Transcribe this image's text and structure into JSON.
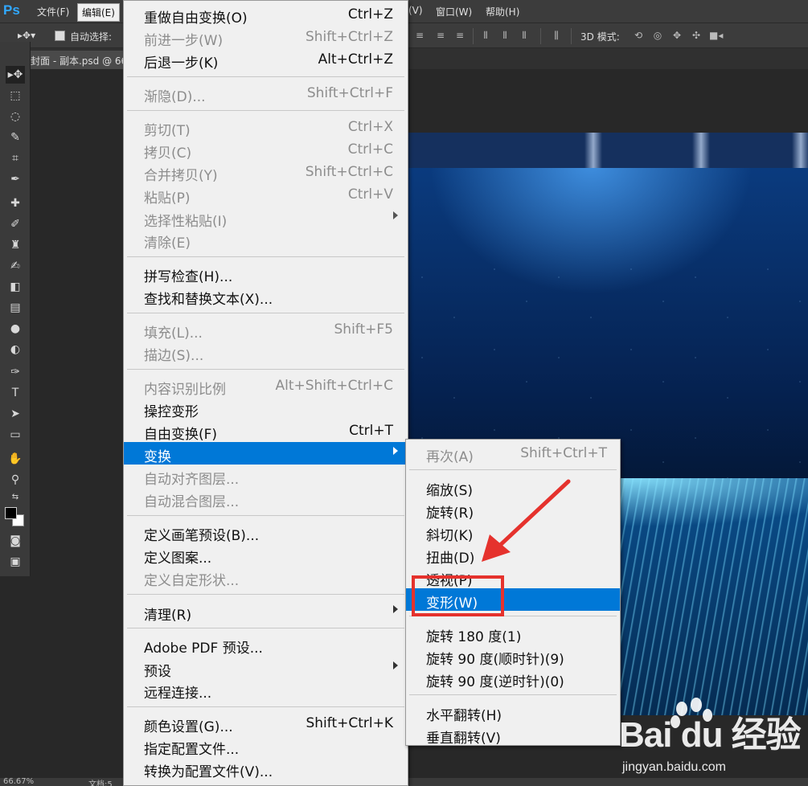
{
  "app": {
    "logo": "Ps",
    "menubar": [
      {
        "label": "文件(F)",
        "active": false
      },
      {
        "label": "编辑(E)",
        "active": true
      },
      {
        "label": "(V)",
        "active": false
      },
      {
        "label": "窗口(W)",
        "active": false
      },
      {
        "label": "帮助(H)",
        "active": false
      }
    ]
  },
  "options_bar": {
    "auto_select_label": "自动选择:",
    "mode_3d_label": "3D 模式:"
  },
  "document": {
    "tab_label": "封面 - 副本.psd @ 66"
  },
  "status": {
    "zoom": "66.67%",
    "doc_label": "文档:5"
  },
  "edit_menu": {
    "items": [
      {
        "label": "重做自由变换(O)",
        "shortcut": "Ctrl+Z",
        "disabled": false
      },
      {
        "label": "前进一步(W)",
        "shortcut": "Shift+Ctrl+Z",
        "disabled": true
      },
      {
        "label": "后退一步(K)",
        "shortcut": "Alt+Ctrl+Z",
        "disabled": false
      },
      {
        "label": "渐隐(D)...",
        "shortcut": "Shift+Ctrl+F",
        "disabled": true
      },
      {
        "label": "剪切(T)",
        "shortcut": "Ctrl+X",
        "disabled": true
      },
      {
        "label": "拷贝(C)",
        "shortcut": "Ctrl+C",
        "disabled": true
      },
      {
        "label": "合并拷贝(Y)",
        "shortcut": "Shift+Ctrl+C",
        "disabled": true
      },
      {
        "label": "粘贴(P)",
        "shortcut": "Ctrl+V",
        "disabled": true
      },
      {
        "label": "选择性粘贴(I)",
        "shortcut": "",
        "disabled": true,
        "submenu": true
      },
      {
        "label": "清除(E)",
        "shortcut": "",
        "disabled": true
      },
      {
        "label": "拼写检查(H)...",
        "shortcut": "",
        "disabled": false
      },
      {
        "label": "查找和替换文本(X)...",
        "shortcut": "",
        "disabled": false
      },
      {
        "label": "填充(L)...",
        "shortcut": "Shift+F5",
        "disabled": true
      },
      {
        "label": "描边(S)...",
        "shortcut": "",
        "disabled": true
      },
      {
        "label": "内容识别比例",
        "shortcut": "Alt+Shift+Ctrl+C",
        "disabled": true
      },
      {
        "label": "操控变形",
        "shortcut": "",
        "disabled": false
      },
      {
        "label": "自由变换(F)",
        "shortcut": "Ctrl+T",
        "disabled": false
      },
      {
        "label": "变换",
        "shortcut": "",
        "disabled": false,
        "submenu": true,
        "highlight": true
      },
      {
        "label": "自动对齐图层...",
        "shortcut": "",
        "disabled": true
      },
      {
        "label": "自动混合图层...",
        "shortcut": "",
        "disabled": true
      },
      {
        "label": "定义画笔预设(B)...",
        "shortcut": "",
        "disabled": false
      },
      {
        "label": "定义图案...",
        "shortcut": "",
        "disabled": false
      },
      {
        "label": "定义自定形状...",
        "shortcut": "",
        "disabled": true
      },
      {
        "label": "清理(R)",
        "shortcut": "",
        "disabled": false,
        "submenu": true
      },
      {
        "label": "Adobe PDF 预设...",
        "shortcut": "",
        "disabled": false
      },
      {
        "label": "预设",
        "shortcut": "",
        "disabled": false,
        "submenu": true
      },
      {
        "label": "远程连接...",
        "shortcut": "",
        "disabled": false
      },
      {
        "label": "颜色设置(G)...",
        "shortcut": "Shift+Ctrl+K",
        "disabled": false
      },
      {
        "label": "指定配置文件...",
        "shortcut": "",
        "disabled": false
      },
      {
        "label": "转换为配置文件(V)...",
        "shortcut": "",
        "disabled": false
      }
    ]
  },
  "transform_submenu": {
    "items": [
      {
        "label": "再次(A)",
        "shortcut": "Shift+Ctrl+T",
        "disabled": true
      },
      {
        "label": "缩放(S)",
        "shortcut": "",
        "disabled": false
      },
      {
        "label": "旋转(R)",
        "shortcut": "",
        "disabled": false
      },
      {
        "label": "斜切(K)",
        "shortcut": "",
        "disabled": false
      },
      {
        "label": "扭曲(D)",
        "shortcut": "",
        "disabled": false
      },
      {
        "label": "透视(P)",
        "shortcut": "",
        "disabled": false
      },
      {
        "label": "变形(W)",
        "shortcut": "",
        "disabled": false,
        "highlight": true
      },
      {
        "label": "旋转 180 度(1)",
        "shortcut": "",
        "disabled": false
      },
      {
        "label": "旋转 90 度(顺时针)(9)",
        "shortcut": "",
        "disabled": false
      },
      {
        "label": "旋转 90 度(逆时针)(0)",
        "shortcut": "",
        "disabled": false
      },
      {
        "label": "水平翻转(H)",
        "shortcut": "",
        "disabled": false
      },
      {
        "label": "垂直翻转(V)",
        "shortcut": "",
        "disabled": false
      }
    ]
  },
  "watermark": {
    "logo": "Bai du 经验",
    "url": "jingyan.baidu.com"
  },
  "colors": {
    "menu_bg": "#f0f0f0",
    "highlight": "#0078d7",
    "annotation_red": "#e5322d"
  }
}
